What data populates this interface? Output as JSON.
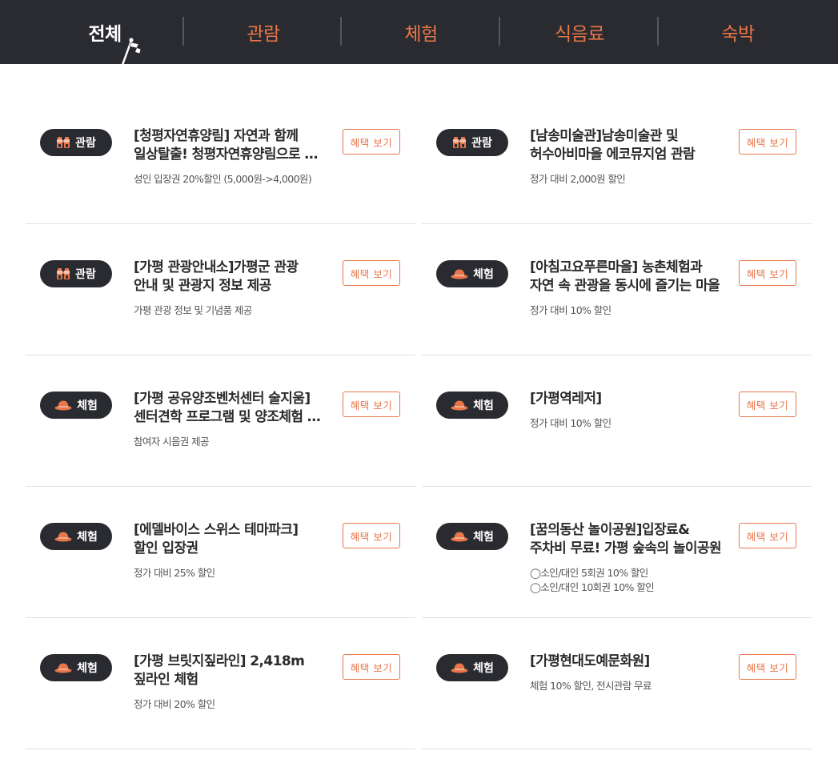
{
  "tabs": [
    {
      "label": "전체",
      "active": true
    },
    {
      "label": "관람",
      "active": false
    },
    {
      "label": "체험",
      "active": false
    },
    {
      "label": "식음료",
      "active": false
    },
    {
      "label": "숙박",
      "active": false
    }
  ],
  "benefit_button_label": "혜택 보기",
  "colors": {
    "accent": "#e8764a",
    "dark": "#2a2b30",
    "divider": "#e1e1e1"
  },
  "items": [
    {
      "category": "관람",
      "icon": "binoculars-icon",
      "title_lines": [
        "[청평자연휴양림] 자연과 함께",
        "일상탈출! 청평자연휴양림으로 떠나요"
      ],
      "desc_lines": [
        "성인 입장권 20%할인 (5,000원->4,000원)"
      ]
    },
    {
      "category": "관람",
      "icon": "binoculars-icon",
      "title_lines": [
        "[남송미술관]남송미술관 및",
        "허수아비마을 에코뮤지엄 관람"
      ],
      "desc_lines": [
        "정가 대비 2,000원 할인"
      ]
    },
    {
      "category": "관람",
      "icon": "binoculars-icon",
      "title_lines": [
        "[가평 관광안내소]가평군 관광",
        "안내 및 관광지 정보 제공"
      ],
      "desc_lines": [
        "가평 관광 정보 및 기념품 제공"
      ]
    },
    {
      "category": "체험",
      "icon": "hat-icon",
      "title_lines": [
        "[아침고요푸른마을] 농촌체험과",
        "자연 속 관광을 동시에 즐기는 마을"
      ],
      "desc_lines": [
        "정가 대비 10% 할인"
      ]
    },
    {
      "category": "체험",
      "icon": "hat-icon",
      "title_lines": [
        "[가평 공유양조벤처센터 술지움]",
        "센터견학 프로그램 및 양조체험 할인"
      ],
      "desc_lines": [
        "참여자 시음권 제공"
      ]
    },
    {
      "category": "체험",
      "icon": "hat-icon",
      "title_lines": [
        "[가평역레저]"
      ],
      "desc_lines": [
        "정가 대비 10% 할인"
      ]
    },
    {
      "category": "체험",
      "icon": "hat-icon",
      "title_lines": [
        "[에델바이스 스위스 테마파크]",
        "할인 입장권"
      ],
      "desc_lines": [
        "정가 대비 25% 할인"
      ]
    },
    {
      "category": "체험",
      "icon": "hat-icon",
      "title_lines": [
        "[꿈의동산 놀이공원]입장료&",
        "주차비 무료! 가평 숲속의 놀이공원"
      ],
      "desc_lines": [
        "◯소인/대인 5회권 10% 할인",
        "◯소인/대인 10회권 10% 할인"
      ]
    },
    {
      "category": "체험",
      "icon": "hat-icon",
      "title_lines": [
        "[가평 브릿지짚라인] 2,418m",
        "짚라인 체험"
      ],
      "desc_lines": [
        "정가 대비 20% 할인"
      ]
    },
    {
      "category": "체험",
      "icon": "hat-icon",
      "title_lines": [
        "[가평현대도예문화원]"
      ],
      "desc_lines": [
        "체험 10% 할인, 전시관람 무료"
      ]
    }
  ]
}
